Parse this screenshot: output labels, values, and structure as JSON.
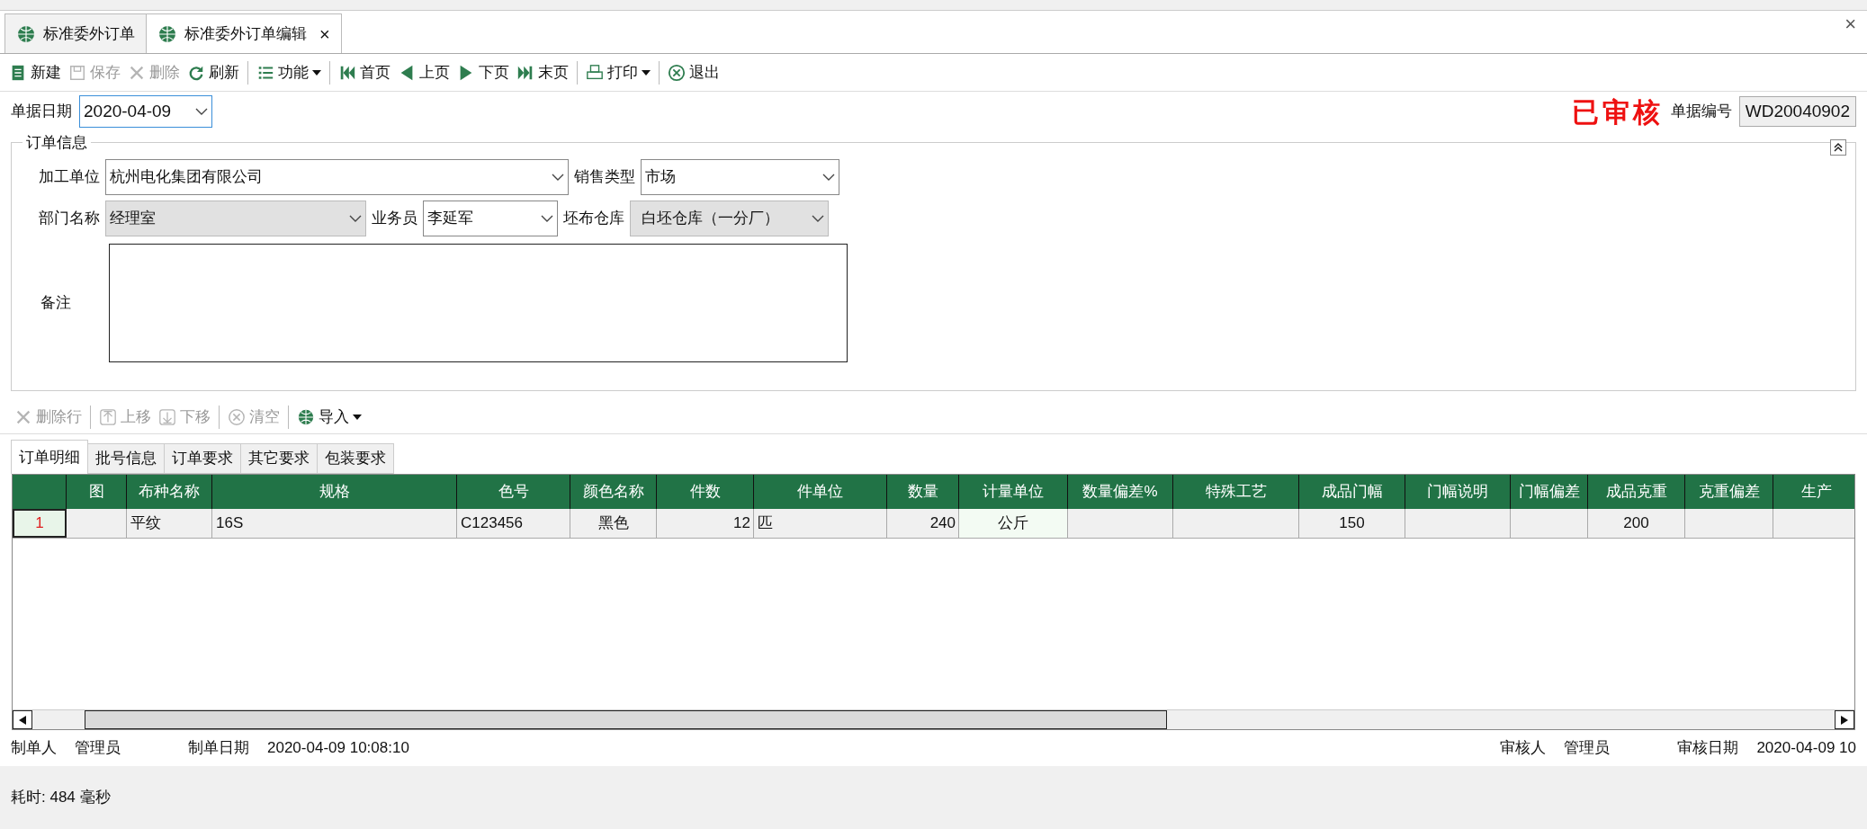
{
  "tabs": [
    {
      "label": "标准委外订单",
      "selected": false,
      "closable": false
    },
    {
      "label": "标准委外订单编辑",
      "selected": true,
      "closable": true
    }
  ],
  "close_glyph": "×",
  "toolbar": [
    {
      "label": "新建",
      "disabled": false
    },
    {
      "label": "保存",
      "disabled": true
    },
    {
      "label": "删除",
      "disabled": true
    },
    {
      "label": "刷新",
      "disabled": false
    },
    {
      "label": "功能",
      "disabled": false,
      "dropdown": true
    },
    {
      "label": "首页",
      "disabled": false
    },
    {
      "label": "上页",
      "disabled": false
    },
    {
      "label": "下页",
      "disabled": false
    },
    {
      "label": "末页",
      "disabled": false
    },
    {
      "label": "打印",
      "disabled": false,
      "dropdown": true
    },
    {
      "label": "退出",
      "disabled": false
    }
  ],
  "date_field": {
    "label": "单据日期",
    "value": "2020-04-09"
  },
  "status_stamp": "已审核",
  "doc_number": {
    "label": "单据编号",
    "value": "WD20040902"
  },
  "order_info": {
    "title": "订单信息",
    "fields": [
      {
        "label": "加工单位",
        "value": "杭州电化集团有限公司",
        "disabled": false
      },
      {
        "label": "销售类型",
        "value": "市场",
        "disabled": false
      },
      {
        "label": "部门名称",
        "value": "经理室",
        "disabled": true
      },
      {
        "label": "业务员",
        "value": "李延军",
        "disabled": false
      },
      {
        "label": "坯布仓库",
        "value": "白坯仓库（一分厂）",
        "disabled": true
      }
    ],
    "remark_label": "备注"
  },
  "row_toolbar": [
    {
      "label": "删除行",
      "disabled": true
    },
    {
      "label": "上移",
      "disabled": true
    },
    {
      "label": "下移",
      "disabled": true
    },
    {
      "label": "清空",
      "disabled": true
    },
    {
      "label": "导入",
      "disabled": false,
      "dropdown": true
    }
  ],
  "detail_tabs": [
    {
      "label": "订单明细",
      "selected": true
    },
    {
      "label": "批号信息",
      "selected": false
    },
    {
      "label": "订单要求",
      "selected": false
    },
    {
      "label": "其它要求",
      "selected": false
    },
    {
      "label": "包装要求",
      "selected": false
    }
  ],
  "table": {
    "columns": [
      "图",
      "布种名称",
      "规格",
      "色号",
      "颜色名称",
      "件数",
      "件单位",
      "数量",
      "计量单位",
      "数量偏差%",
      "特殊工艺",
      "成品门幅",
      "门幅说明",
      "门幅偏差",
      "成品克重",
      "克重偏差",
      "生产"
    ],
    "rows": [
      {
        "number": "1",
        "cells": [
          "",
          "平纹",
          "16S",
          "C123456",
          "黑色",
          "12",
          "匹",
          "240",
          "公斤",
          "",
          "",
          "150",
          "",
          "",
          "200",
          "",
          ""
        ]
      }
    ]
  },
  "footer": [
    {
      "label": "制单人",
      "value": "管理员"
    },
    {
      "label": "制单日期",
      "value": "2020-04-09 10:08:10"
    },
    {
      "label": "审核人",
      "value": "管理员"
    },
    {
      "label": "审核日期",
      "value": "2020-04-09 10"
    }
  ],
  "status_bar": "耗时: 484 毫秒"
}
